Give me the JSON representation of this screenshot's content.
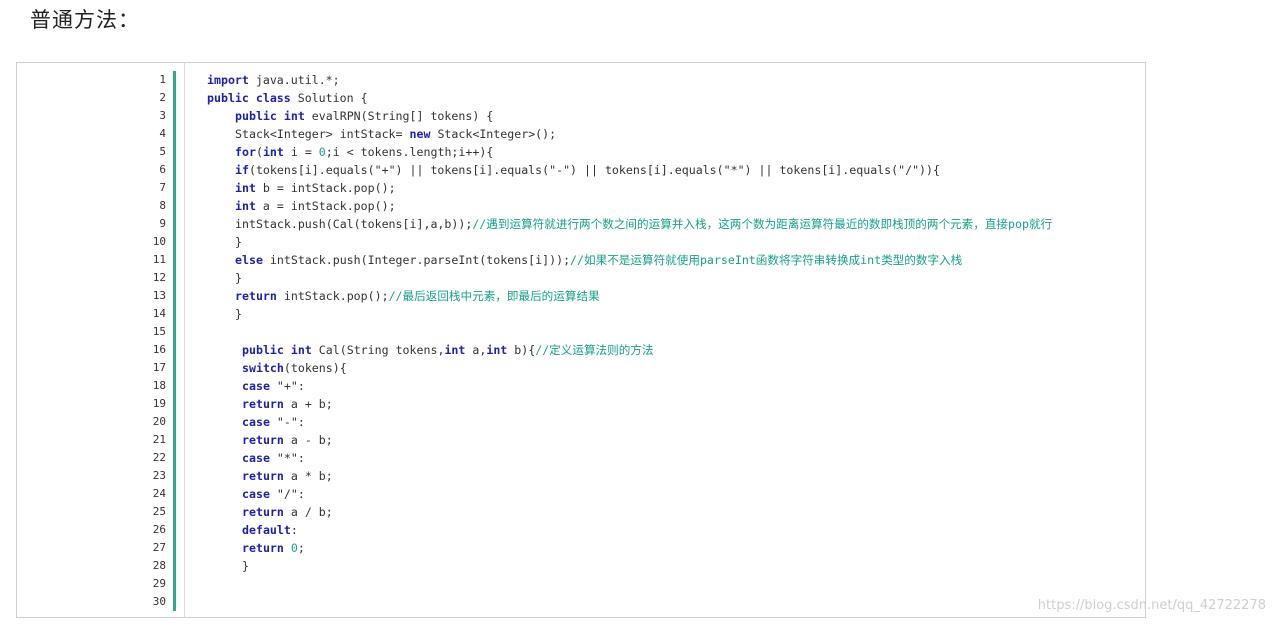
{
  "heading": "普通方法：",
  "watermark": "https://blog.csdn.net/qq_42722278",
  "code_lines": [
    {
      "n": "1",
      "indent": 0,
      "parts": [
        {
          "t": "import",
          "c": "kw"
        },
        {
          "t": " java.util.*;",
          "c": ""
        }
      ]
    },
    {
      "n": "2",
      "indent": 0,
      "parts": [
        {
          "t": "public class",
          "c": "kw"
        },
        {
          "t": " Solution {",
          "c": ""
        }
      ]
    },
    {
      "n": "3",
      "indent": 4,
      "parts": [
        {
          "t": "public int",
          "c": "kw"
        },
        {
          "t": " evalRPN(String[] tokens) {",
          "c": ""
        }
      ]
    },
    {
      "n": "4",
      "indent": 4,
      "parts": [
        {
          "t": "Stack<Integer> intStack= ",
          "c": ""
        },
        {
          "t": "new",
          "c": "kw"
        },
        {
          "t": " Stack<Integer>();",
          "c": ""
        }
      ]
    },
    {
      "n": "5",
      "indent": 4,
      "parts": [
        {
          "t": "for",
          "c": "kw"
        },
        {
          "t": "(",
          "c": ""
        },
        {
          "t": "int",
          "c": "kw"
        },
        {
          "t": " i = ",
          "c": ""
        },
        {
          "t": "0",
          "c": "nm"
        },
        {
          "t": ";i < tokens.length;i++){",
          "c": ""
        }
      ]
    },
    {
      "n": "6",
      "indent": 4,
      "parts": [
        {
          "t": "if",
          "c": "kw"
        },
        {
          "t": "(tokens[i].equals(\"+\") || tokens[i].equals(\"-\") || tokens[i].equals(\"*\") || tokens[i].equals(\"/\")){",
          "c": ""
        }
      ]
    },
    {
      "n": "7",
      "indent": 4,
      "parts": [
        {
          "t": "int",
          "c": "kw"
        },
        {
          "t": " b = intStack.pop();",
          "c": ""
        }
      ]
    },
    {
      "n": "8",
      "indent": 4,
      "parts": [
        {
          "t": "int",
          "c": "kw"
        },
        {
          "t": " a = intStack.pop();",
          "c": ""
        }
      ]
    },
    {
      "n": "9",
      "indent": 4,
      "parts": [
        {
          "t": "intStack.push(Cal(tokens[i],a,b));",
          "c": ""
        },
        {
          "t": "//遇到运算符就进行两个数之间的运算并入栈，这两个数为距离运算符最近的数即栈顶的两个元素，直接pop就行",
          "c": "cm"
        }
      ]
    },
    {
      "n": "10",
      "indent": 4,
      "parts": [
        {
          "t": "}",
          "c": ""
        }
      ]
    },
    {
      "n": "11",
      "indent": 4,
      "parts": [
        {
          "t": "else",
          "c": "kw"
        },
        {
          "t": " intStack.push(Integer.parseInt(tokens[i]));",
          "c": ""
        },
        {
          "t": "//如果不是运算符就使用parseInt函数将字符串转换成int类型的数字入栈",
          "c": "cm"
        }
      ]
    },
    {
      "n": "12",
      "indent": 4,
      "parts": [
        {
          "t": "}",
          "c": ""
        }
      ]
    },
    {
      "n": "13",
      "indent": 4,
      "parts": [
        {
          "t": "return",
          "c": "kw"
        },
        {
          "t": " intStack.pop();",
          "c": ""
        },
        {
          "t": "//最后返回栈中元素，即最后的运算结果",
          "c": "cm"
        }
      ]
    },
    {
      "n": "14",
      "indent": 4,
      "parts": [
        {
          "t": "}",
          "c": ""
        }
      ]
    },
    {
      "n": "15",
      "indent": 0,
      "parts": []
    },
    {
      "n": "16",
      "indent": 5,
      "parts": [
        {
          "t": "public int",
          "c": "kw"
        },
        {
          "t": " Cal(String tokens,",
          "c": ""
        },
        {
          "t": "int",
          "c": "kw"
        },
        {
          "t": " a,",
          "c": ""
        },
        {
          "t": "int",
          "c": "kw"
        },
        {
          "t": " b){",
          "c": ""
        },
        {
          "t": "//定义运算法则的方法",
          "c": "cm"
        }
      ]
    },
    {
      "n": "17",
      "indent": 5,
      "parts": [
        {
          "t": "switch",
          "c": "kw"
        },
        {
          "t": "(tokens){",
          "c": ""
        }
      ]
    },
    {
      "n": "18",
      "indent": 5,
      "parts": [
        {
          "t": "case",
          "c": "kw"
        },
        {
          "t": " \"+\":",
          "c": ""
        }
      ]
    },
    {
      "n": "19",
      "indent": 5,
      "parts": [
        {
          "t": "return",
          "c": "kw"
        },
        {
          "t": " a + b;",
          "c": ""
        }
      ]
    },
    {
      "n": "20",
      "indent": 5,
      "parts": [
        {
          "t": "case",
          "c": "kw"
        },
        {
          "t": " \"-\":",
          "c": ""
        }
      ]
    },
    {
      "n": "21",
      "indent": 5,
      "parts": [
        {
          "t": "return",
          "c": "kw"
        },
        {
          "t": " a - b;",
          "c": ""
        }
      ]
    },
    {
      "n": "22",
      "indent": 5,
      "parts": [
        {
          "t": "case",
          "c": "kw"
        },
        {
          "t": " \"*\":",
          "c": ""
        }
      ]
    },
    {
      "n": "23",
      "indent": 5,
      "parts": [
        {
          "t": "return",
          "c": "kw"
        },
        {
          "t": " a * b;",
          "c": ""
        }
      ]
    },
    {
      "n": "24",
      "indent": 5,
      "parts": [
        {
          "t": "case",
          "c": "kw"
        },
        {
          "t": " \"/\":",
          "c": ""
        }
      ]
    },
    {
      "n": "25",
      "indent": 5,
      "parts": [
        {
          "t": "return",
          "c": "kw"
        },
        {
          "t": " a / b;",
          "c": ""
        }
      ]
    },
    {
      "n": "26",
      "indent": 5,
      "parts": [
        {
          "t": "default",
          "c": "kw"
        },
        {
          "t": ":",
          "c": ""
        }
      ]
    },
    {
      "n": "27",
      "indent": 5,
      "parts": [
        {
          "t": "return",
          "c": "kw"
        },
        {
          "t": " ",
          "c": ""
        },
        {
          "t": "0",
          "c": "nm"
        },
        {
          "t": ";",
          "c": ""
        }
      ]
    },
    {
      "n": "28",
      "indent": 5,
      "parts": [
        {
          "t": "}",
          "c": ""
        }
      ]
    },
    {
      "n": "29",
      "indent": 0,
      "parts": []
    },
    {
      "n": "30",
      "indent": 0,
      "parts": []
    }
  ]
}
